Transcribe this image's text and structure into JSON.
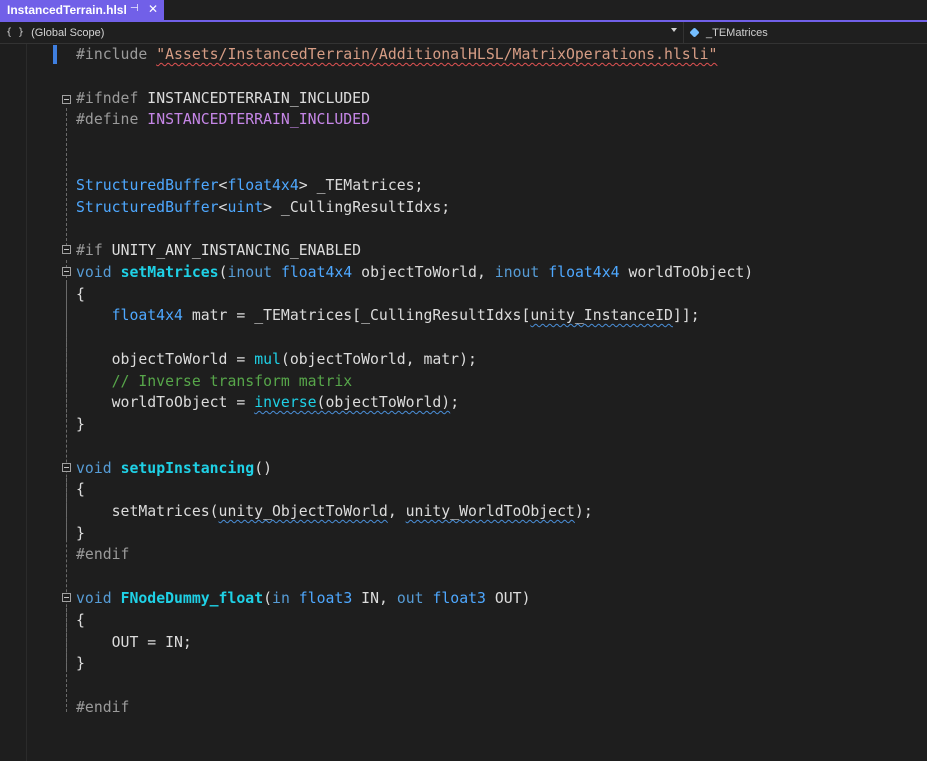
{
  "tab": {
    "title": "InstancedTerrain.hlsl",
    "pin_glyph": "⊣",
    "close_glyph": "✕"
  },
  "navbar": {
    "scope_icon": "{ }",
    "scope_label": "(Global Scope)",
    "member_label": "_TEMatrices"
  },
  "code": {
    "l1_kw": "#include",
    "l1_str": "\"Assets/InstancedTerrain/AdditionalHLSL/MatrixOperations.hlsli\"",
    "l3_kw": "#ifndef",
    "l3_name": "INSTANCEDTERRAIN_INCLUDED",
    "l4_kw": "#define",
    "l4_name": "INSTANCEDTERRAIN_INCLUDED",
    "l7_type": "StructuredBuffer",
    "l7_lt": "<",
    "l7_targ": "float4x4",
    "l7_rest": "> _TEMatrices;",
    "l8_type": "StructuredBuffer",
    "l8_lt": "<",
    "l8_targ": "uint",
    "l8_rest": "> _CullingResultIdxs;",
    "l10_kw": "#if",
    "l10_name": "UNITY_ANY_INSTANCING_ENABLED",
    "l11_void": "void",
    "l11_fn": "setMatrices",
    "l11_p1": "(",
    "l11_inout1": "inout",
    "l11_t1": "float4x4",
    "l11_a1": "objectToWorld,",
    "l11_inout2": "inout",
    "l11_t2": "float4x4",
    "l11_a2": "worldToObject)",
    "l12": "{",
    "l13_type": "float4x4",
    "l13_a": " matr = _TEMatrices[_CullingResultIdxs[",
    "l13_sq": "unity_InstanceID",
    "l13_b": "]];",
    "l15_a": "objectToWorld = ",
    "l15_fn": "mul",
    "l15_b": "(objectToWorld, matr);",
    "l16_cm": "// Inverse transform matrix",
    "l17_a": "worldToObject = ",
    "l17_fn": "inverse",
    "l17_sq": "(objectToWorld)",
    "l17_b": ";",
    "l18": "}",
    "l20_void": "void",
    "l20_fn": "setupInstancing",
    "l20_rest": "()",
    "l21": "{",
    "l22_a": "setMatrices(",
    "l22_sq1": "unity_ObjectToWorld",
    "l22_mid": ", ",
    "l22_sq2": "unity_WorldToObject",
    "l22_b": ");",
    "l23": "}",
    "l24": "#endif",
    "l26_void": "void",
    "l26_fn": "FNodeDummy_float",
    "l26_p": "(",
    "l26_in": "in",
    "l26_t1": "float3",
    "l26_a1": "IN,",
    "l26_out": "out",
    "l26_t2": "float3",
    "l26_a2": "OUT)",
    "l27": "{",
    "l28": "OUT = IN;",
    "l29": "}",
    "l31": "#endif"
  }
}
